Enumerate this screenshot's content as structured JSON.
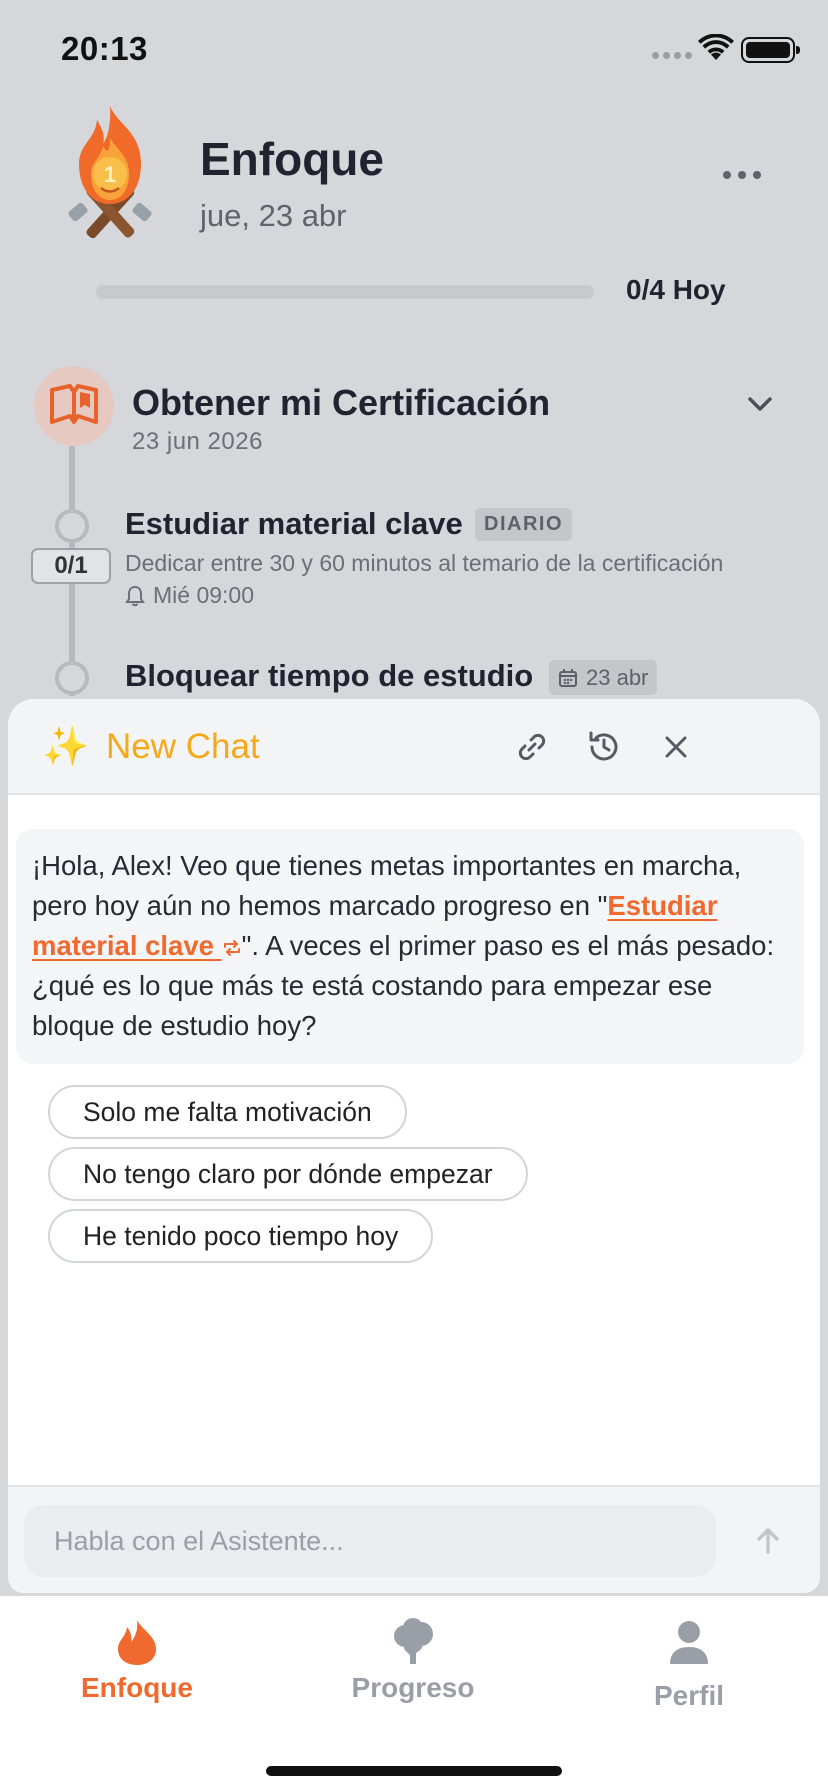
{
  "status_bar": {
    "time": "20:13"
  },
  "header": {
    "title": "Enfoque",
    "date": "jue, 23 abr"
  },
  "daily_progress": {
    "label": "0/4 Hoy",
    "done": 0,
    "total": 4,
    "fraction": 0.0
  },
  "goal": {
    "title": "Obtener mi Certificación",
    "date": "23 jun 2026",
    "tasks": [
      {
        "count": "0/1",
        "title": "Estudiar material clave",
        "badge": "DIARIO",
        "description": "Dedicar entre 30 y 60 minutos al temario de la certificación",
        "reminder": "Mié 09:00"
      },
      {
        "title": "Bloquear tiempo de estudio",
        "date_badge": "23 abr"
      }
    ]
  },
  "chat": {
    "title": "New Chat",
    "message": {
      "part1": "¡Hola, Alex! Veo que tienes metas importantes en marcha, pero hoy aún no hemos marcado progreso en \"",
      "link": "Estudiar material clave",
      "part2": "\". A veces el primer paso es el más pesado: ¿qué es lo que más te está costando para empezar ese bloque de estudio hoy?"
    },
    "suggestions": [
      "Solo me falta motivación",
      "No tengo claro por dónde empezar",
      "He tenido poco tiempo hoy"
    ],
    "input_placeholder": "Habla con el Asistente..."
  },
  "tabs": [
    {
      "label": "Enfoque",
      "icon": "flame-icon",
      "active": true
    },
    {
      "label": "Progreso",
      "icon": "tree-icon",
      "active": false
    },
    {
      "label": "Perfil",
      "icon": "person-icon",
      "active": false
    }
  ],
  "colors": {
    "accent": "#f06a30",
    "chat_title": "#f5a91a",
    "inactive_tab": "#9a9ea6"
  }
}
